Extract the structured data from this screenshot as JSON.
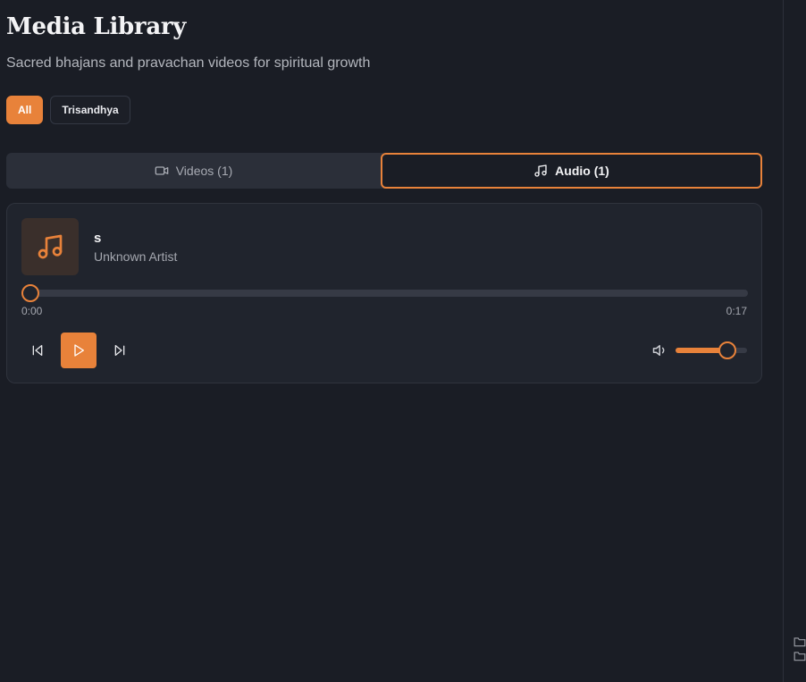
{
  "header": {
    "title": "Media Library",
    "subtitle": "Sacred bhajans and pravachan videos for spiritual growth"
  },
  "filters": [
    {
      "label": "All",
      "active": true
    },
    {
      "label": "Trisandhya",
      "active": false
    }
  ],
  "tabs": [
    {
      "label": "Videos (1)",
      "icon": "video-icon",
      "active": false
    },
    {
      "label": "Audio (1)",
      "icon": "music-note-icon",
      "active": true
    }
  ],
  "player": {
    "cover_icon": "music-note-icon",
    "title": "s",
    "artist": "Unknown Artist",
    "current_time": "0:00",
    "duration": "0:17",
    "progress": 0,
    "volume": 0.72,
    "controls": [
      "skip-back-icon",
      "play-icon",
      "skip-forward-icon"
    ],
    "volume_icon": "volume-icon"
  },
  "colors": {
    "accent": "#e8823a",
    "background": "#1a1d25",
    "card": "#20242d"
  }
}
